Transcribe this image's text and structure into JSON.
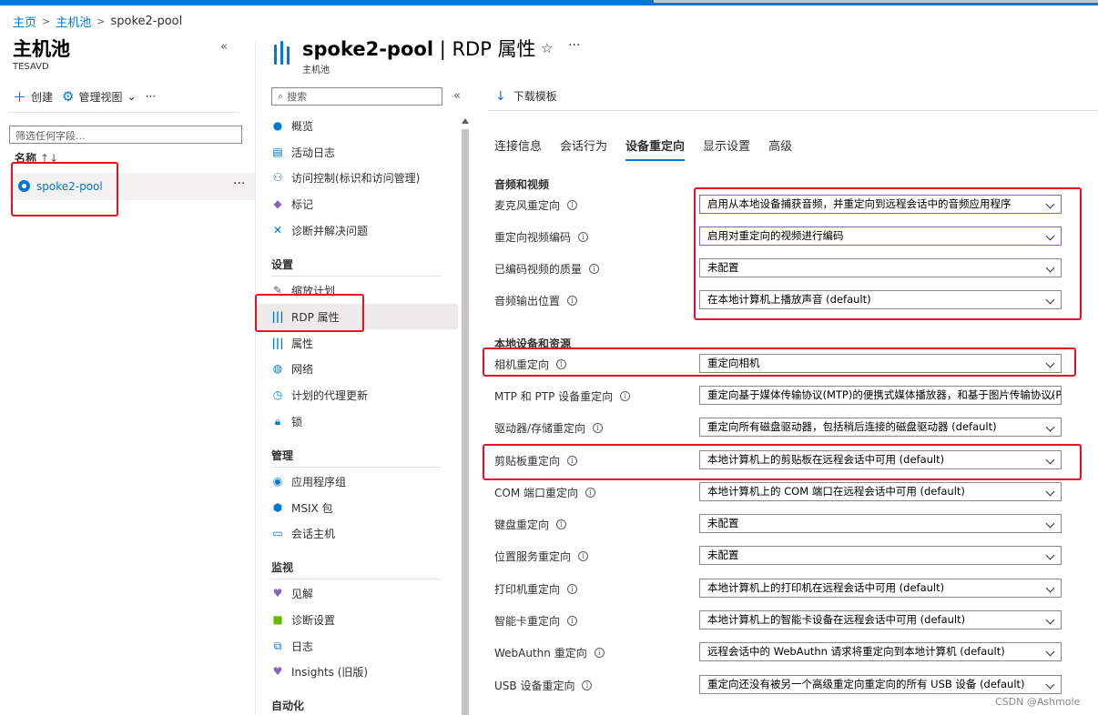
{
  "breadcrumb": {
    "home": "主页",
    "hostpools": "主机池",
    "current": "spoke2-pool"
  },
  "left": {
    "title": "主机池",
    "subtitle": "TESAVD",
    "toolbar": {
      "create": "创建",
      "manage_view": "管理视图",
      "more": "···"
    },
    "filter_placeholder": "筛选任何字段...",
    "column_name": "名称",
    "sort_arrow": "↑↓",
    "rows": [
      {
        "name": "spoke2-pool"
      }
    ],
    "collapse": "«"
  },
  "resource": {
    "title_bold": "spoke2-pool",
    "title_rest": " | RDP 属性",
    "subtitle": "主机池",
    "star": "☆",
    "more": "···"
  },
  "nav": {
    "search_placeholder": "搜索",
    "collapse": "«",
    "items": [
      {
        "label": "概览",
        "icon": "overview-icon"
      },
      {
        "label": "活动日志",
        "icon": "activity-log-icon"
      },
      {
        "label": "访问控制(标识和访问管理)",
        "icon": "iam-icon"
      },
      {
        "label": "标记",
        "icon": "tag-icon"
      },
      {
        "label": "诊断并解决问题",
        "icon": "diagnose-icon"
      }
    ],
    "section_settings": "设置",
    "settings": [
      {
        "label": "缩放计划"
      },
      {
        "label": "RDP 属性"
      },
      {
        "label": "属性"
      },
      {
        "label": "网络"
      },
      {
        "label": "计划的代理更新"
      },
      {
        "label": "锁"
      }
    ],
    "section_manage": "管理",
    "manage": [
      {
        "label": "应用程序组"
      },
      {
        "label": "MSIX 包"
      },
      {
        "label": "会话主机"
      }
    ],
    "section_monitor": "监视",
    "monitor": [
      {
        "label": "见解"
      },
      {
        "label": "诊断设置"
      },
      {
        "label": "日志"
      },
      {
        "label": "Insights (旧版)"
      }
    ],
    "section_automation": "自动化"
  },
  "content": {
    "download": "下载模板",
    "tabs": [
      "连接信息",
      "会话行为",
      "设备重定向",
      "显示设置",
      "高级"
    ],
    "section_av": "音频和视频",
    "av_fields": [
      {
        "label": "麦克风重定向",
        "value": "启用从本地设备捕获音频，并重定向到远程会话中的音频应用程序"
      },
      {
        "label": "重定向视频编码",
        "value": "启用对重定向的视频进行编码"
      },
      {
        "label": "已编码视频的质量",
        "value": "未配置"
      },
      {
        "label": "音频输出位置",
        "value": "在本地计算机上播放声音 (default)"
      }
    ],
    "section_local": "本地设备和资源",
    "local_fields": [
      {
        "label": "相机重定向",
        "value": "重定向相机"
      },
      {
        "label": "MTP 和 PTP 设备重定向",
        "value": "重定向基于媒体传输协议(MTP)的便携式媒体播放器，和基于图片传输协议(PTP)的数码相机"
      },
      {
        "label": "驱动器/存储重定向",
        "value": "重定向所有磁盘驱动器，包括稍后连接的磁盘驱动器 (default)"
      },
      {
        "label": "剪贴板重定向",
        "value": "本地计算机上的剪贴板在远程会话中可用 (default)"
      },
      {
        "label": "COM 端口重定向",
        "value": "本地计算机上的 COM 端口在远程会话中可用 (default)"
      },
      {
        "label": "键盘重定向",
        "value": "未配置"
      },
      {
        "label": "位置服务重定向",
        "value": "未配置"
      },
      {
        "label": "打印机重定向",
        "value": "本地计算机上的打印机在远程会话中可用 (default)"
      },
      {
        "label": "智能卡重定向",
        "value": "本地计算机上的智能卡设备在远程会话中可用 (default)"
      },
      {
        "label": "WebAuthn 重定向",
        "value": "远程会话中的 WebAuthn 请求将重定向到本地计算机 (default)"
      },
      {
        "label": "USB 设备重定向",
        "value": "重定向还没有被另一个高级重定向重定向的所有 USB 设备 (default)"
      }
    ]
  },
  "watermark": "CSDN @Ashmole",
  "colors": {
    "accent": "#0078d4",
    "highlight": "#e81123"
  }
}
